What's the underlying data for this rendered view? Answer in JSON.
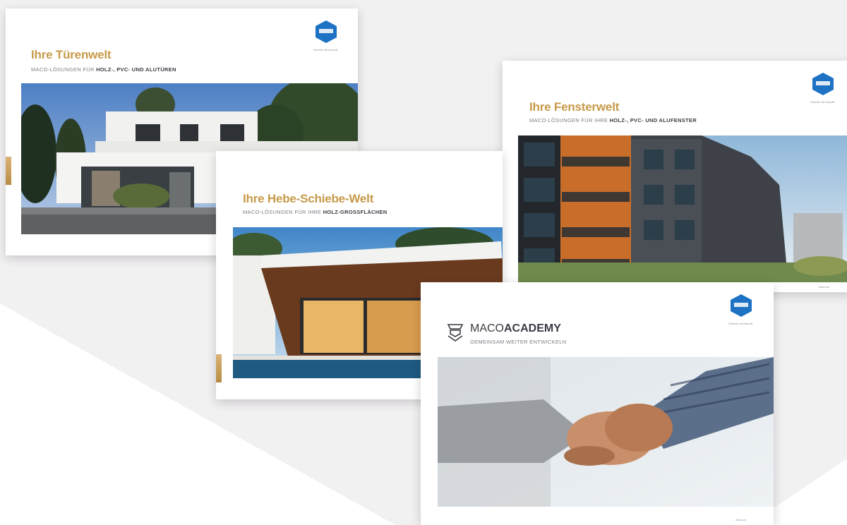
{
  "colors": {
    "background": "#f2f1f2",
    "accent_gold": "#c79a48",
    "logo_blue": "#1d72c3",
    "text_gray": "#7c8088"
  },
  "cards": [
    {
      "title": "Ihre Türenwelt",
      "subtitle_pre": "MACO-LÖSUNGEN FÜR ",
      "subtitle_bold": "HOLZ-, PVC- UND ALUTÜREN",
      "logo_tag": "Technik mit Zukunft"
    },
    {
      "title": "Ihre Hebe-Schiebe-Welt",
      "subtitle_pre": "MACO-LÖSUNGEN FÜR IHRE ",
      "subtitle_bold": "HOLZ-GROSSFLÄCHEN"
    },
    {
      "title": "Ihre Fensterwelt",
      "subtitle_pre": "MACO-LÖSUNGEN FÜR IHRE ",
      "subtitle_bold": "HOLZ-, PVC- UND ALUFENSTER",
      "logo_tag": "Technik mit Zukunft",
      "footer": "maco.eu"
    },
    {
      "title_light": "MACO",
      "title_bold": "ACADEMY",
      "subtitle": "GEMEINSAM WEITER ENTWICKELN",
      "logo_tag": "Technik mit Zukunft",
      "footer": "maco.eu"
    }
  ],
  "icons": [
    "maco-logo-icon",
    "academy-hat-icon"
  ]
}
